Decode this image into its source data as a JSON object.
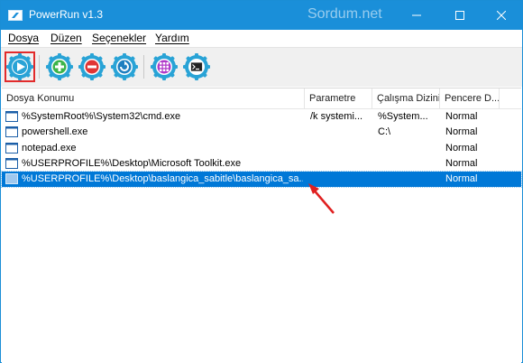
{
  "window": {
    "title": "PowerRun v1.3",
    "watermark": "Sordum.net"
  },
  "menu": [
    {
      "label": "Dosya"
    },
    {
      "label": "Düzen"
    },
    {
      "label": "Seçenekler"
    },
    {
      "label": "Yardım"
    }
  ],
  "toolbar": {
    "buttons": [
      "run-icon",
      "add-icon",
      "remove-icon",
      "refresh-icon",
      "grid-icon",
      "cmd-icon"
    ]
  },
  "table": {
    "columns": [
      "Dosya Konumu",
      "Parametre",
      "Çalışma Dizini",
      "Pencere D..."
    ],
    "rows": [
      {
        "path": "%SystemRoot%\\System32\\cmd.exe",
        "param": "/k systemi...",
        "dir": "%System...",
        "window": "Normal"
      },
      {
        "path": "powershell.exe",
        "param": "",
        "dir": "C:\\",
        "window": "Normal"
      },
      {
        "path": "notepad.exe",
        "param": "",
        "dir": "",
        "window": "Normal"
      },
      {
        "path": "%USERPROFILE%\\Desktop\\Microsoft Toolkit.exe",
        "param": "",
        "dir": "",
        "window": "Normal"
      },
      {
        "path": "%USERPROFILE%\\Desktop\\baslangica_sabitle\\baslangica_sa...",
        "param": "",
        "dir": "",
        "window": "Normal",
        "selected": true
      }
    ]
  },
  "colors": {
    "titlebar": "#1a8fd9",
    "selection": "#0078d7",
    "arrow": "#e02020",
    "gear": "#29a3d6"
  }
}
